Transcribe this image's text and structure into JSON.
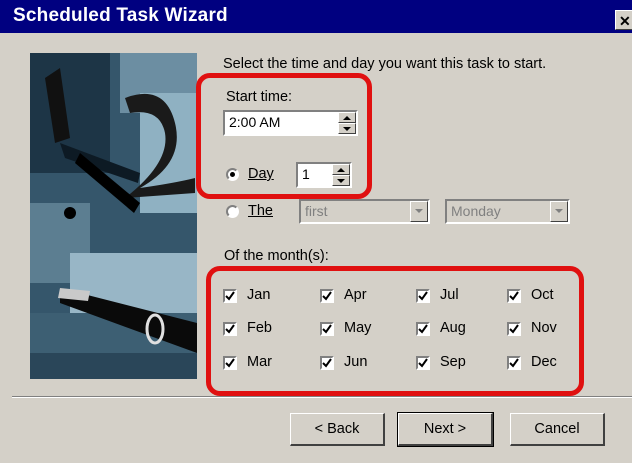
{
  "window": {
    "title": "Scheduled Task Wizard",
    "close_glyph": "✕"
  },
  "instructions": "Select the time and day you want this task to start.",
  "start_time": {
    "label": "Start time:",
    "value": "2:00 AM"
  },
  "day_option": {
    "label": "Day",
    "selected": true,
    "value": "1"
  },
  "the_option": {
    "label": "The",
    "selected": false,
    "week_value": "first",
    "weekday_value": "Monday"
  },
  "months": {
    "label": "Of the month(s):",
    "items": [
      {
        "label": "Jan",
        "checked": true
      },
      {
        "label": "Apr",
        "checked": true
      },
      {
        "label": "Jul",
        "checked": true
      },
      {
        "label": "Oct",
        "checked": true
      },
      {
        "label": "Feb",
        "checked": true
      },
      {
        "label": "May",
        "checked": true
      },
      {
        "label": "Aug",
        "checked": true
      },
      {
        "label": "Nov",
        "checked": true
      },
      {
        "label": "Mar",
        "checked": true
      },
      {
        "label": "Jun",
        "checked": true
      },
      {
        "label": "Sep",
        "checked": true
      },
      {
        "label": "Dec",
        "checked": true
      }
    ]
  },
  "buttons": {
    "back": "< Back",
    "next": "Next >",
    "cancel": "Cancel"
  },
  "colors": {
    "titlebar": "#000080",
    "face": "#d4d0c8",
    "highlight": "#e01010"
  }
}
